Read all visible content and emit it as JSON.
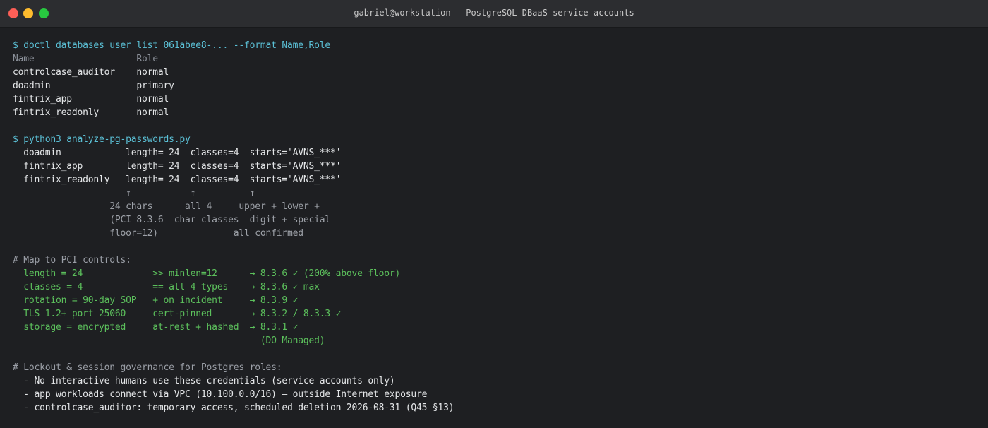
{
  "window": {
    "title": "gabriel@workstation — PostgreSQL DBaaS service accounts"
  },
  "terminal": {
    "lines": [
      {
        "text": "$ doctl databases user list 061abee8-... --format Name,Role",
        "style": "cmd"
      },
      {
        "text": "Name                   Role",
        "style": "header"
      },
      {
        "text": "controlcase_auditor    normal",
        "style": "plain"
      },
      {
        "text": "doadmin                primary",
        "style": "plain"
      },
      {
        "text": "fintrix_app            normal",
        "style": "plain"
      },
      {
        "text": "fintrix_readonly       normal",
        "style": "plain"
      },
      {
        "text": "",
        "style": "plain"
      },
      {
        "text": "$ python3 analyze-pg-passwords.py",
        "style": "cmd"
      },
      {
        "text": "  doadmin            length= 24  classes=4  starts='AVNS_***'",
        "style": "plain"
      },
      {
        "text": "  fintrix_app        length= 24  classes=4  starts='AVNS_***'",
        "style": "plain"
      },
      {
        "text": "  fintrix_readonly   length= 24  classes=4  starts='AVNS_***'",
        "style": "plain"
      },
      {
        "text": "                     ↑           ↑          ↑",
        "style": "note"
      },
      {
        "text": "                  24 chars      all 4     upper + lower +",
        "style": "note"
      },
      {
        "text": "                  (PCI 8.3.6  char classes  digit + special",
        "style": "note"
      },
      {
        "text": "                  floor=12)              all confirmed",
        "style": "note"
      },
      {
        "text": "",
        "style": "plain"
      },
      {
        "text": "# Map to PCI controls:",
        "style": "comment"
      },
      {
        "text": "  length = 24             >> minlen=12      → 8.3.6 ✓ (200% above floor)",
        "style": "ok"
      },
      {
        "text": "  classes = 4             == all 4 types    → 8.3.6 ✓ max",
        "style": "ok"
      },
      {
        "text": "  rotation = 90-day SOP   + on incident     → 8.3.9 ✓",
        "style": "ok"
      },
      {
        "text": "  TLS 1.2+ port 25060     cert-pinned       → 8.3.2 / 8.3.3 ✓",
        "style": "ok"
      },
      {
        "text": "  storage = encrypted     at-rest + hashed  → 8.3.1 ✓",
        "style": "ok"
      },
      {
        "text": "                                              (DO Managed)",
        "style": "ok"
      },
      {
        "text": "",
        "style": "plain"
      },
      {
        "text": "# Lockout & session governance for Postgres roles:",
        "style": "comment"
      },
      {
        "text": "  - No interactive humans use these credentials (service accounts only)",
        "style": "plain"
      },
      {
        "text": "  - app workloads connect via VPC (10.100.0.0/16) — outside Internet exposure",
        "style": "plain"
      },
      {
        "text": "  - controlcase_auditor: temporary access, scheduled deletion 2026-08-31 (Q45 §13)",
        "style": "plain"
      }
    ]
  }
}
